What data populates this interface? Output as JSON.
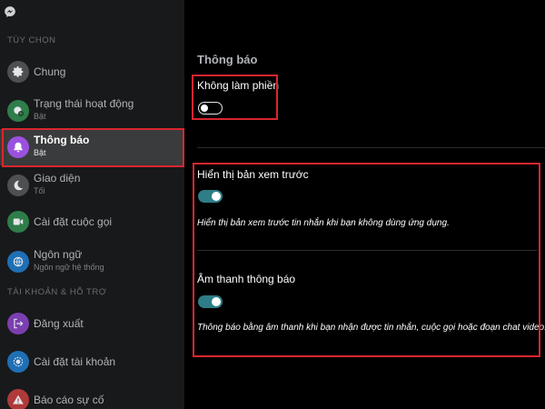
{
  "sidebar": {
    "section_options": "TÙY CHỌN",
    "section_account": "TÀI KHOẢN & HỖ TRỢ",
    "items": [
      {
        "label": "Chung",
        "icon": "gear-icon",
        "color": "#4e4f50"
      },
      {
        "label": "Trạng thái hoạt động",
        "sub": "Bật",
        "icon": "activity-status-icon",
        "color": "#2f7d4a"
      },
      {
        "label": "Thông báo",
        "sub": "Bật",
        "icon": "bell-icon",
        "color": "#9b51e0"
      },
      {
        "label": "Giao diện",
        "sub": "Tối",
        "icon": "moon-icon",
        "color": "#4e4f50"
      },
      {
        "label": "Cài đặt cuộc gọi",
        "icon": "video-camera-icon",
        "color": "#2f7d4a"
      },
      {
        "label": "Ngôn ngữ",
        "sub": "Ngôn ngữ hệ thống",
        "icon": "globe-icon",
        "color": "#1f6fb5"
      },
      {
        "label": "Đăng xuất",
        "icon": "logout-icon",
        "color": "#7b3fb0"
      },
      {
        "label": "Cài đặt tài khoản",
        "icon": "account-settings-icon",
        "color": "#1f6fb5"
      },
      {
        "label": "Báo cáo sự cố",
        "icon": "warning-icon",
        "color": "#b0393a"
      }
    ]
  },
  "main": {
    "title": "Thông báo",
    "dnd": {
      "label": "Không làm phiền",
      "enabled": false
    },
    "preview": {
      "label": "Hiển thị bản xem trước",
      "desc": "Hiển thị bản xem trước tin nhắn khi bạn không dùng ứng dụng.",
      "enabled": true
    },
    "sound": {
      "label": "Âm thanh thông báo",
      "desc": "Thông báo bằng âm thanh khi bạn nhận được tin nhắn, cuộc gọi hoặc đoạn chat video.",
      "enabled": true
    }
  },
  "colors": {
    "accent_toggle": "#2e7d87",
    "highlight": "#d9262f",
    "sidebar_bg": "#18191a",
    "active_bg": "#3a3b3c"
  }
}
